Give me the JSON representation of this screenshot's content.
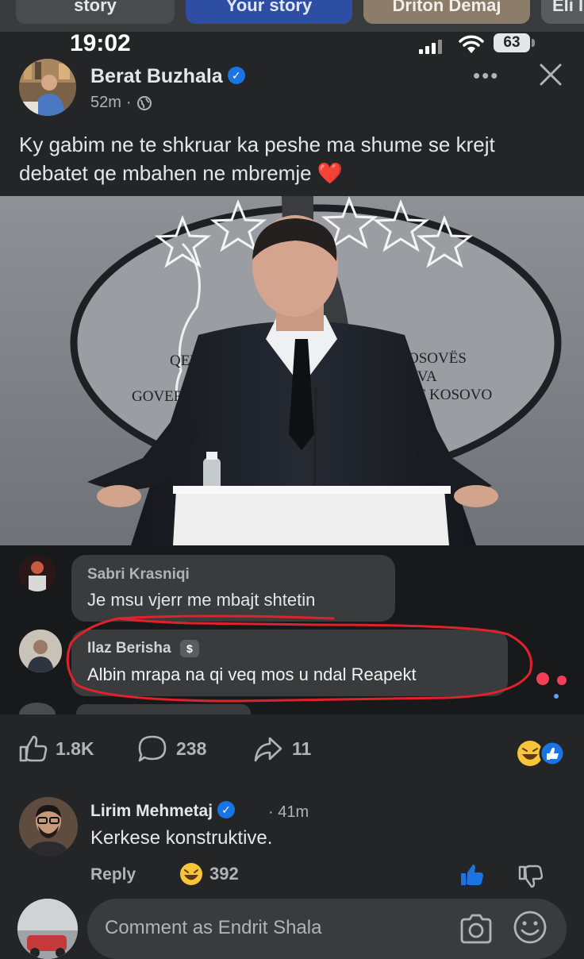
{
  "stories": {
    "items": [
      {
        "label": "story"
      },
      {
        "label": "Your story"
      },
      {
        "label": "Driton Demaj"
      },
      {
        "label": "Eli I"
      }
    ]
  },
  "status_bar": {
    "time": "19:02",
    "battery": "63"
  },
  "post": {
    "author": "Berat Buzhala",
    "time": "52m",
    "caption": "Ky gabim ne te shkruar ka peshe ma shume se krejt debatet qe mbahen ne mbremje ❤️",
    "photo": {
      "emblem_text_left_1": "QEV",
      "emblem_text_left_2": "GOVERN",
      "emblem_text_right_1": "OSOVËS",
      "emblem_text_right_2": "OVA",
      "emblem_text_right_3": "OF KOSOVO"
    },
    "screenshot_comments": [
      {
        "name": "Sabri Krasniqi",
        "text": "Je msu vjerr me mbajt shtetin"
      },
      {
        "name": "Ilaz Berisha",
        "text": "Albin mrapa na qi veq mos u ndal Reapekt"
      }
    ],
    "stats": {
      "likes": "1.8K",
      "comments": "238",
      "shares": "11"
    }
  },
  "comment": {
    "author": "Lirim Mehmetaj",
    "time": "41m",
    "text": "Kerkese konstruktive.",
    "reply_label": "Reply",
    "reaction_count": "392"
  },
  "composer": {
    "placeholder": "Comment as Endrit Shala"
  },
  "colors": {
    "accent": "#1b74e4",
    "background": "#242526",
    "annotation_red": "#e0222b"
  }
}
